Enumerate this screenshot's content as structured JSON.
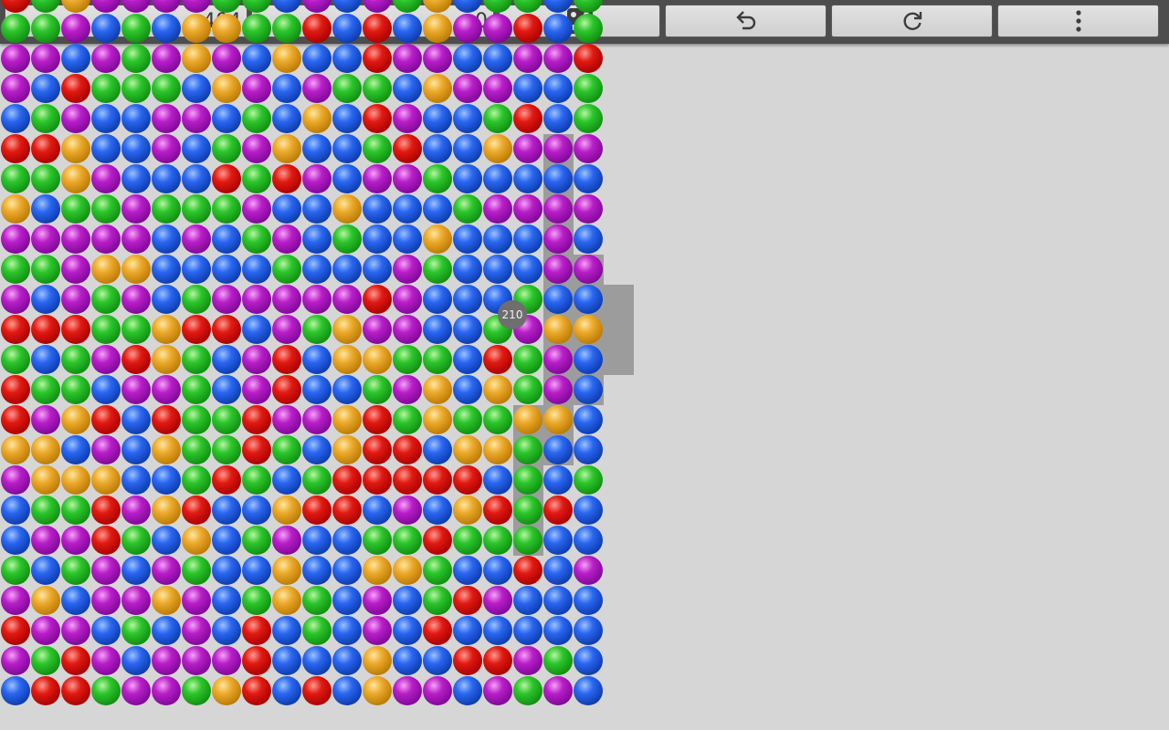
{
  "toolbar": {
    "score": "404",
    "selection_score": "0",
    "dice_icon": "dice-icon",
    "undo_icon": "undo-icon",
    "restart_icon": "restart-icon",
    "menu_icon": "more-vert-icon"
  },
  "board": {
    "colors": {
      "r": "#d81b14",
      "p": "#a21ab6",
      "b": "#1f57d8",
      "o": "#e29d23",
      "g": "#22b322"
    },
    "columns": [
      "bprpgbbporrgrpgpogrbppgrro",
      "rgpobpgoopgbrbgpbgrgbpgggo",
      "rrpbgpgoboggrpppgooprbpop",
      "gpbpprroprbpggopgpbbgpbpbbp",
      "pbgpbgpbbbprgpoppbbbgggpgpgb",
      "ppbopboborpoobbbgbppgpbpbppp",
      "gpppgorgggggrgbpgbbpboopbrgr",
      "opbbbbbrggbbrpbbgrgbopogbrro",
      "rrrgbgbgrrppbpbgpgpgpbggbbrg",
      "bbboopobgprrppgpbrobbogbrpbgb",
      "rbggbbrgbpbbgpbbbpbopbrppppgr",
      "bbbbbbrrooboopbgobbbgbbbprbbb",
      "ooppogbrrrgoprbbbpgrgrrpbrpob",
      "pbbbogprrgpgpppbbprpbpbgpbbpr",
      "pbrggrbrboogbbgobgbbopoopgggbbbbbb",
      "brbrbgorogbbbbbbgbbbpbpbbgroggpppbbbbbb",
      "prbpbgrbogorgbbbpbogpbpgrpbbpoorrppopb",
      "gpbbrggggoggpgbbpbprbprggorbbbppbbbggbg",
      "pgbbbbrbboppobpppbpbbpbbrorppbpbbpbbbbbb",
      "bbbbpbbgbbbbobpbpbpggrgggpppgogbbbbbbbbb"
    ]
  }
}
